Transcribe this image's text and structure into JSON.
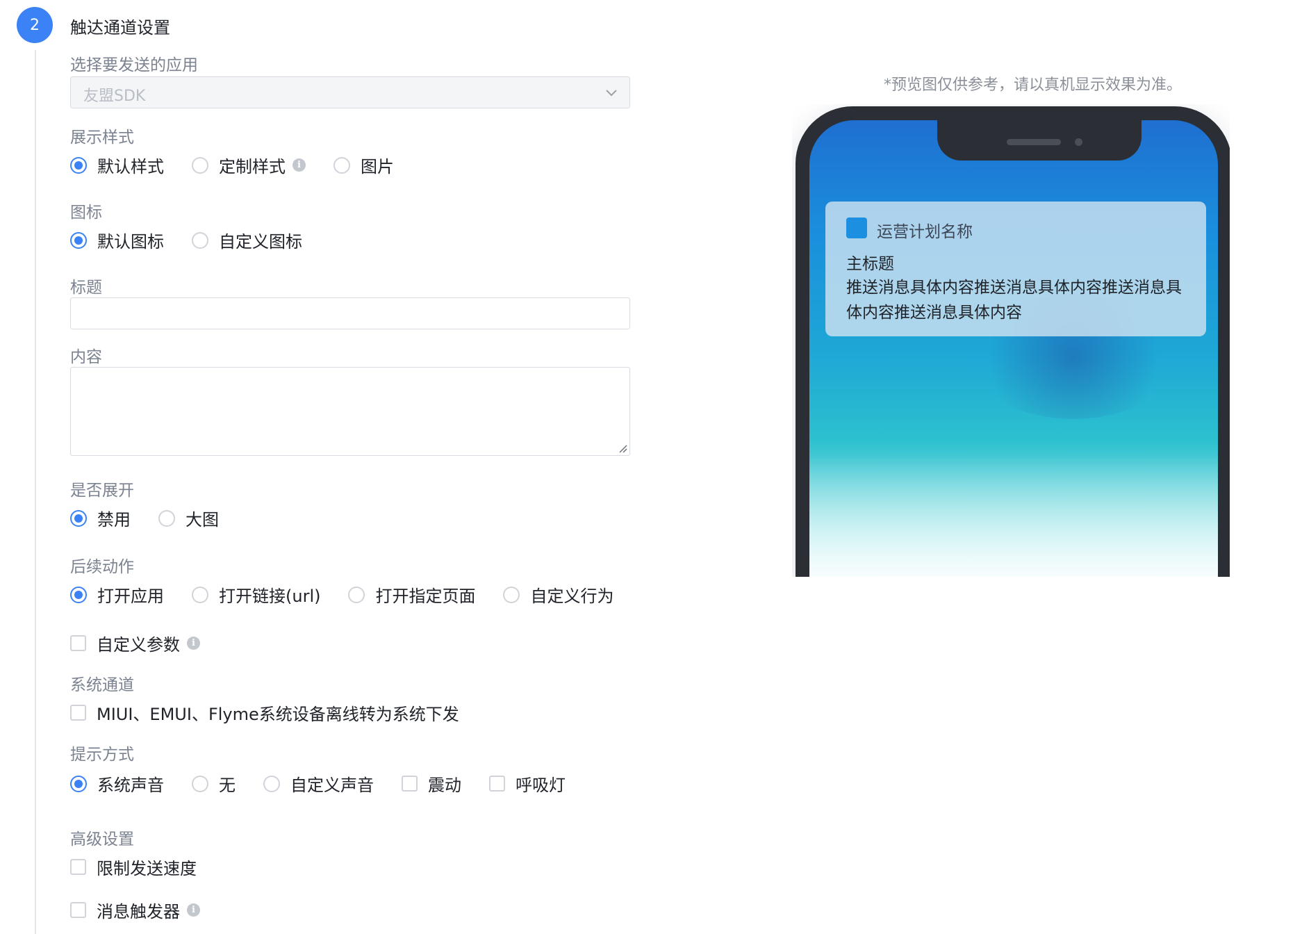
{
  "step": {
    "number": "2",
    "title": "触达通道设置"
  },
  "app_select": {
    "label": "选择要发送的应用",
    "value": "友盟SDK"
  },
  "display_style": {
    "label": "展示样式",
    "options": [
      "默认样式",
      "定制样式",
      "图片"
    ],
    "selected": 0
  },
  "icon": {
    "label": "图标",
    "options": [
      "默认图标",
      "自定义图标"
    ],
    "selected": 0
  },
  "title_field": {
    "label": "标题",
    "value": ""
  },
  "content_field": {
    "label": "内容",
    "value": ""
  },
  "expand": {
    "label": "是否展开",
    "options": [
      "禁用",
      "大图"
    ],
    "selected": 0
  },
  "follow_action": {
    "label": "后续动作",
    "options": [
      "打开应用",
      "打开链接(url)",
      "打开指定页面",
      "自定义行为"
    ],
    "selected": 0
  },
  "custom_params": {
    "label": "自定义参数",
    "checked": false
  },
  "system_channel": {
    "label": "系统通道",
    "checkbox_label": "MIUI、EMUI、Flyme系统设备离线转为系统下发",
    "checked": false
  },
  "alert_mode": {
    "label": "提示方式",
    "radios": [
      "系统声音",
      "无",
      "自定义声音"
    ],
    "selected": 0,
    "checks": [
      "震动",
      "呼吸灯"
    ]
  },
  "advanced": {
    "label": "高级设置",
    "rate_limit": "限制发送速度",
    "message_trigger": "消息触发器"
  },
  "preview": {
    "note": "*预览图仅供参考，请以真机显示效果为准。",
    "app_name": "运营计划名称",
    "title": "主标题",
    "body": "推送消息具体内容推送消息具体内容推送消息具体内容推送消息具体内容"
  },
  "colors": {
    "accent": "#3b82f6",
    "label": "#7b8290",
    "notification_icon": "#1d8fe0"
  }
}
